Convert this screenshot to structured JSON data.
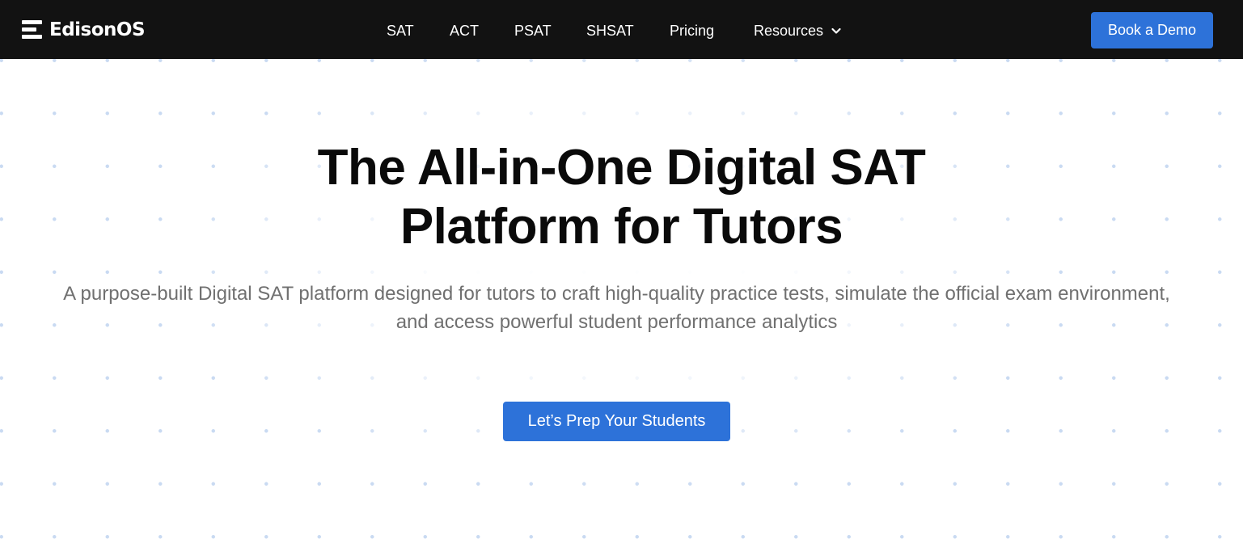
{
  "header": {
    "logo_text": "EdisonOS",
    "nav": {
      "sat": "SAT",
      "act": "ACT",
      "psat": "PSAT",
      "shsat": "SHSAT",
      "pricing": "Pricing",
      "resources": "Resources"
    },
    "resources_icon": "chevron-down-icon",
    "demo_button": "Book a Demo"
  },
  "hero": {
    "title_line1": "The All-in-One Digital SAT",
    "title_line2": "Platform for Tutors",
    "subtitle": "A purpose-built Digital SAT platform designed for tutors to craft high-quality practice tests, simulate the official exam environment, and access powerful student performance analytics",
    "cta_label": "Let’s Prep Your Students"
  },
  "colors": {
    "navbar_bg": "#121212",
    "accent": "#2d72d9",
    "dot_pattern": "#c9daf2",
    "subtitle_text": "#707070"
  }
}
